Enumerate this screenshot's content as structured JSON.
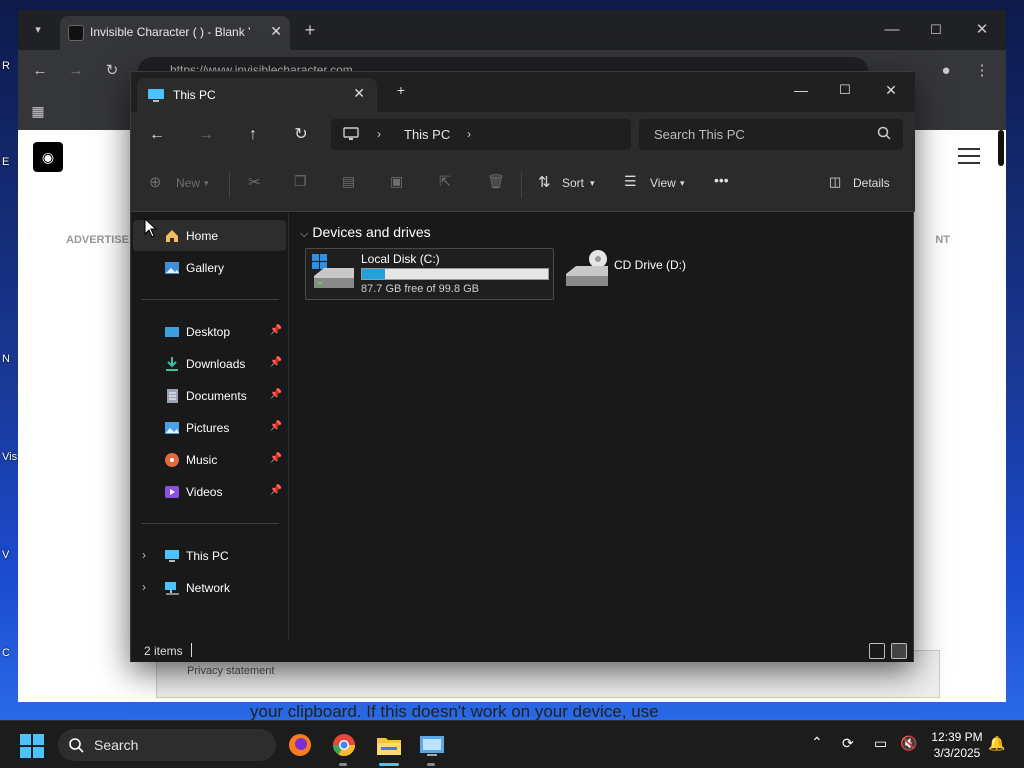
{
  "browser": {
    "tab_title": "Invisible Character (   ) - Blank Y",
    "address_text": "https://www.invisiblecharacter.com",
    "advertise_label": "ADVERTISE",
    "ad_right_fragment": "NT",
    "bottom_card_text": "Privacy statement",
    "bottom_page_text": "your clipboard. If this doesn't work on your device, use"
  },
  "desktop": {
    "icons": [
      "R",
      "E",
      "N",
      "Vis",
      "V",
      "C"
    ]
  },
  "explorer": {
    "tab_title": "This PC",
    "breadcrumb": "This PC",
    "search_placeholder": "Search This PC",
    "commands": {
      "new": "New",
      "sort": "Sort",
      "view": "View",
      "more": "•••",
      "details": "Details"
    },
    "nav": {
      "home": "Home",
      "gallery": "Gallery",
      "desktop": "Desktop",
      "downloads": "Downloads",
      "documents": "Documents",
      "pictures": "Pictures",
      "music": "Music",
      "videos": "Videos",
      "this_pc": "This PC",
      "network": "Network"
    },
    "group_header": "Devices and drives",
    "drives": [
      {
        "name": "Local Disk (C:)",
        "free_text": "87.7 GB free of 99.8 GB",
        "used_fraction": 0.121
      },
      {
        "name": "CD Drive (D:)"
      }
    ],
    "status": "2 items"
  },
  "taskbar": {
    "search_label": "Search",
    "time": "12:39 PM",
    "date": "3/3/2025"
  },
  "colors": {
    "accent": "#4cc2ff",
    "drive_bar": "#26a0da",
    "explorer_bg": "#191919"
  }
}
